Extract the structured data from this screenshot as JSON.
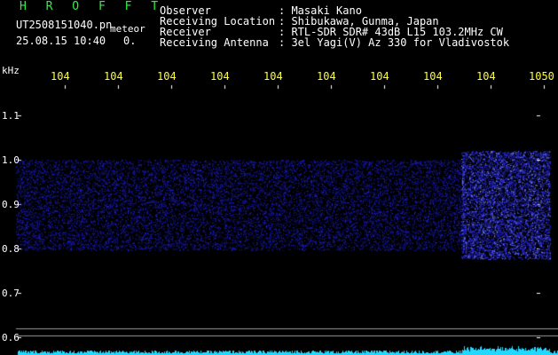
{
  "header": {
    "logo": "H R O F F T",
    "filename": "UT2508151040.pn",
    "datetime": "25.08.15 10:40",
    "zero": "0.",
    "meteor": "meteor",
    "fields": [
      {
        "label": "Observer",
        "value": ": Masaki Kano"
      },
      {
        "label": "Receiving Location",
        "value": ": Shibukawa, Gunma, Japan"
      },
      {
        "label": "Receiver",
        "value": ": RTL-SDR SDR# 43dB L15 103.2MHz CW"
      },
      {
        "label": "Receiving Antenna",
        "value": ": 3el Yagi(V) Az 330 for Vladivostok"
      }
    ]
  },
  "axis": {
    "unit": "kHz",
    "y_labels": [
      "1.1",
      "1.0",
      "0.9",
      "0.8",
      "0.7",
      "0.6"
    ],
    "x_labels": [
      "104",
      "104",
      "104",
      "104",
      "104",
      "104",
      "104",
      "104",
      "104",
      "1050"
    ]
  },
  "colors": {
    "background": "#000000",
    "noise": "#2a2aff",
    "tick": "#ffff33",
    "logo": "#33ee44",
    "level": "#22d8ff"
  }
}
